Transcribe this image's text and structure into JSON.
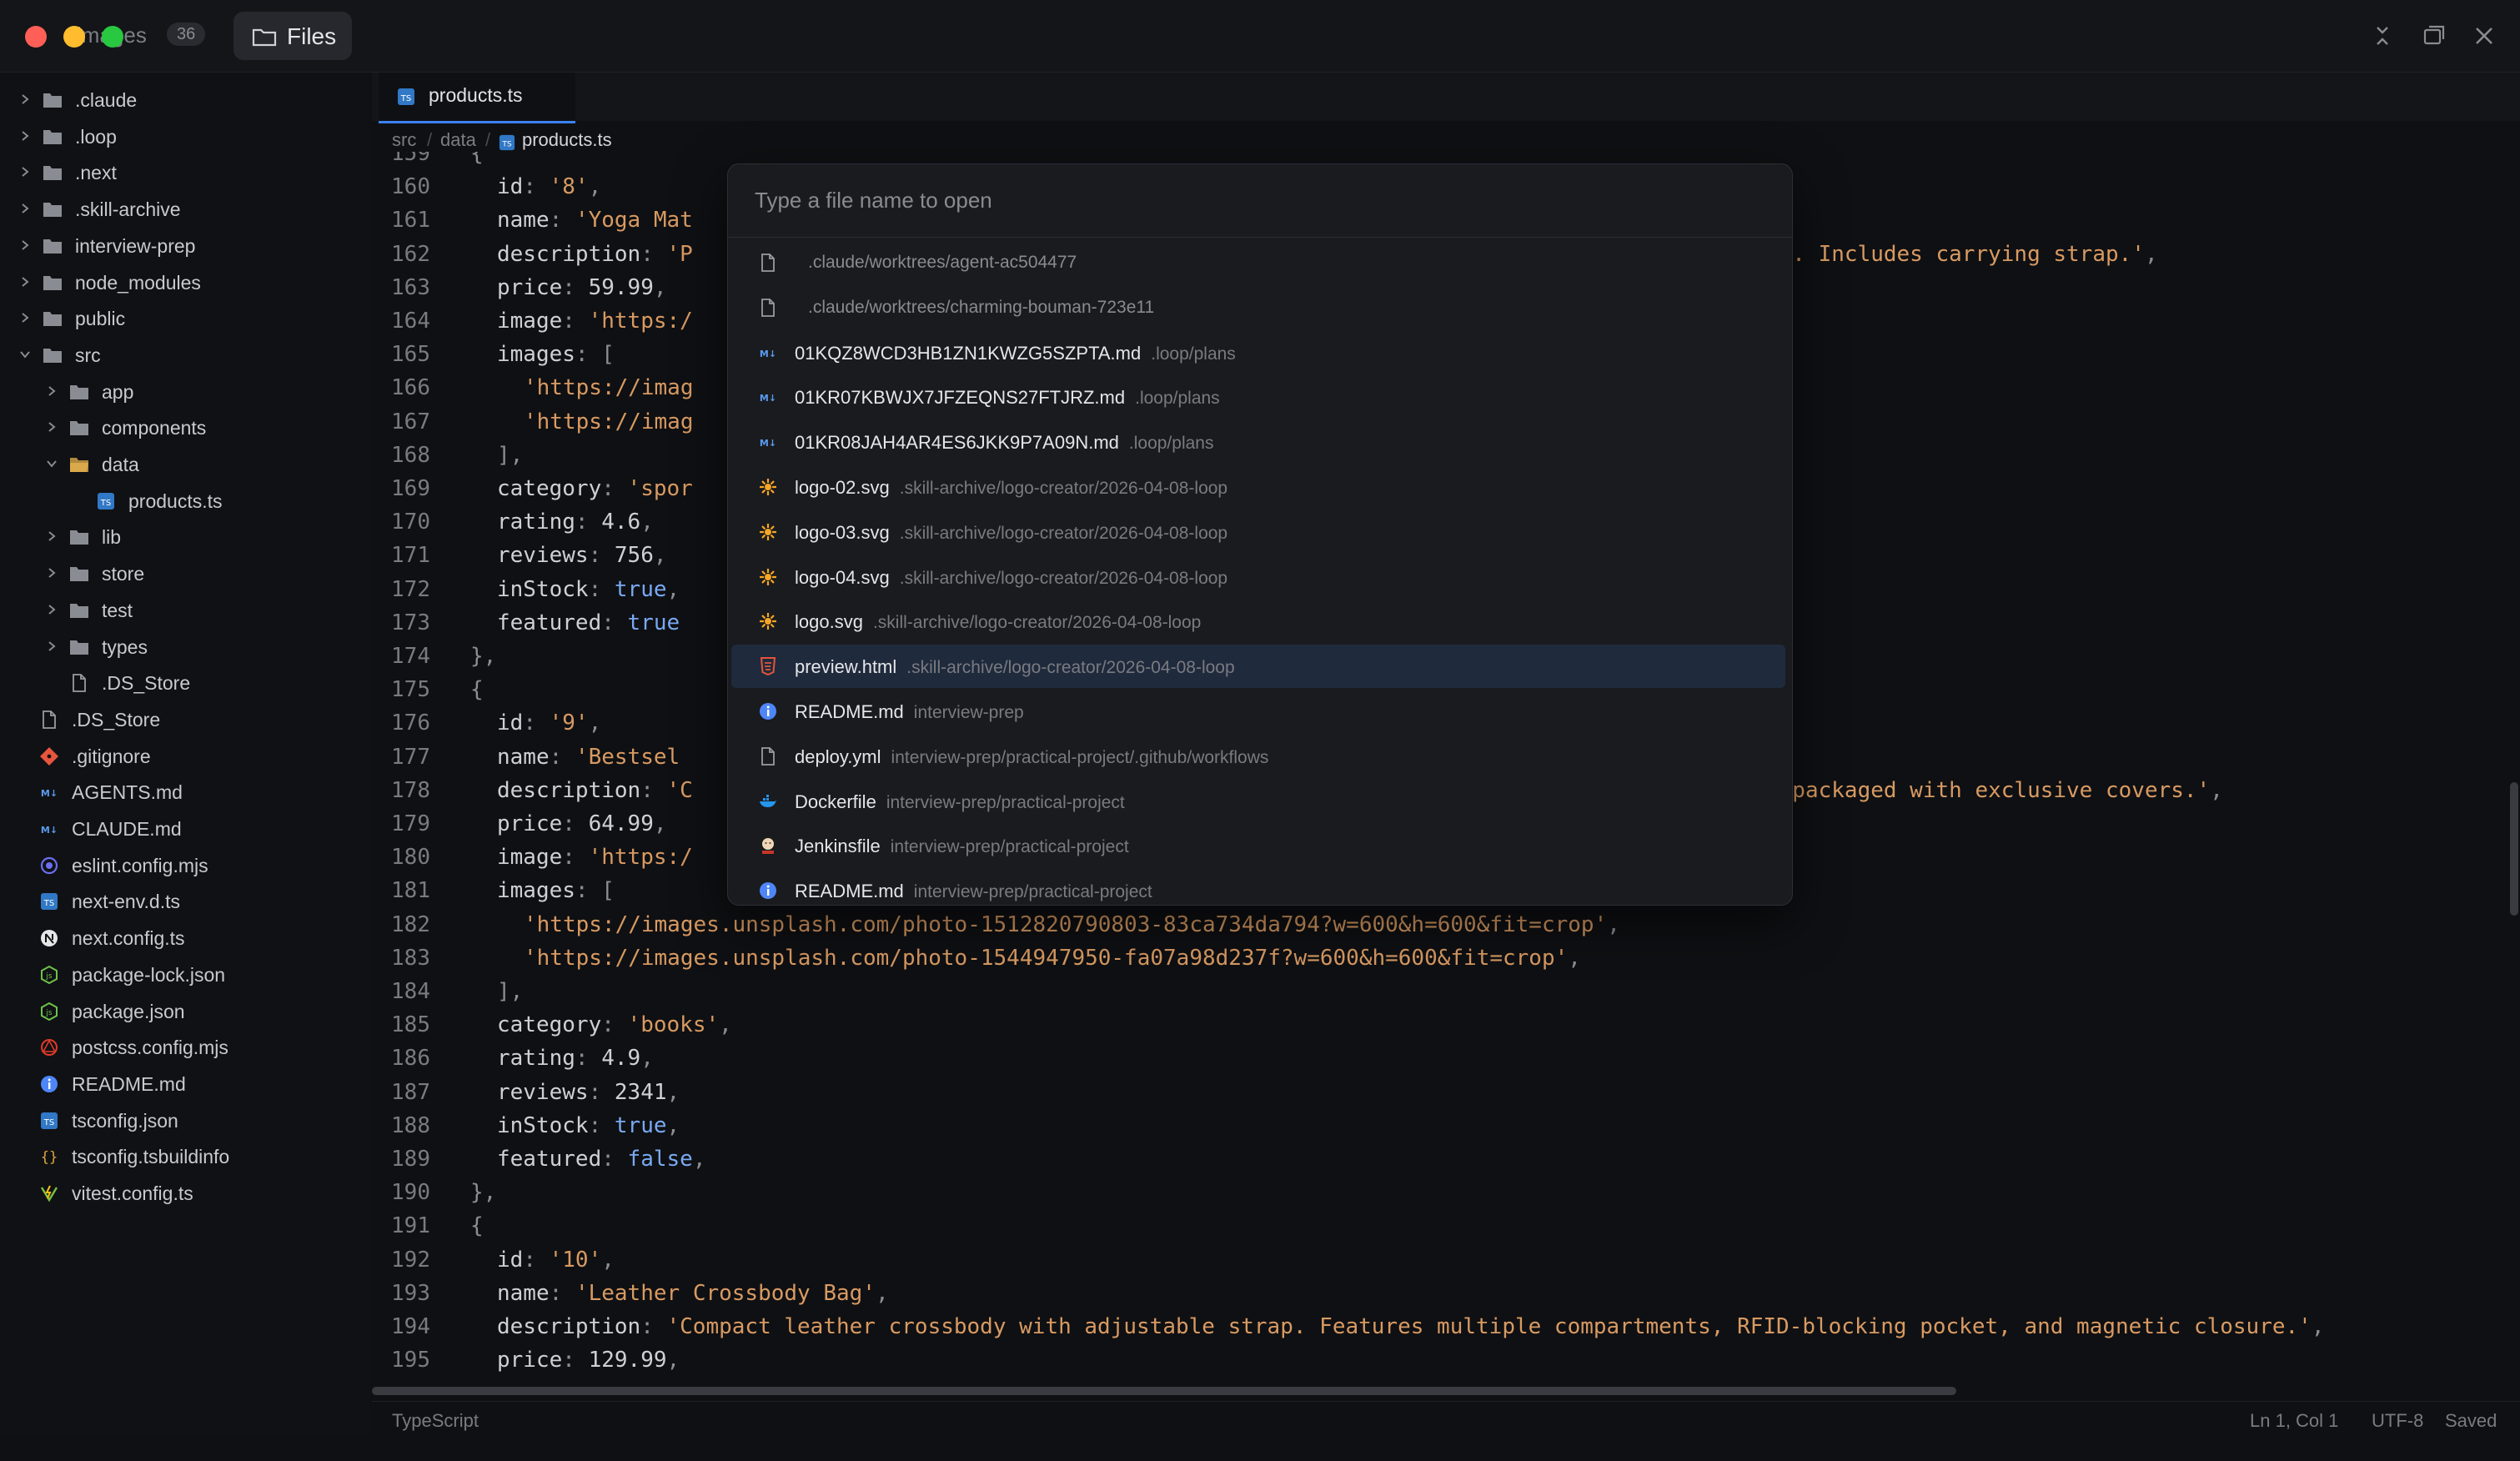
{
  "titlebar": {
    "app_title": "images",
    "count": "36",
    "files_tab": "Files"
  },
  "sidebar": {
    "items": [
      {
        "label": ".claude",
        "depth": 0,
        "kind": "folder",
        "expanded": false
      },
      {
        "label": ".loop",
        "depth": 0,
        "kind": "folder",
        "expanded": false
      },
      {
        "label": ".next",
        "depth": 0,
        "kind": "folder",
        "expanded": false
      },
      {
        "label": ".skill-archive",
        "depth": 0,
        "kind": "folder",
        "expanded": false
      },
      {
        "label": "interview-prep",
        "depth": 0,
        "kind": "folder",
        "expanded": false
      },
      {
        "label": "node_modules",
        "depth": 0,
        "kind": "folder",
        "expanded": false
      },
      {
        "label": "public",
        "depth": 0,
        "kind": "folder",
        "expanded": false
      },
      {
        "label": "src",
        "depth": 0,
        "kind": "folder",
        "expanded": true
      },
      {
        "label": "app",
        "depth": 1,
        "kind": "folder",
        "expanded": false
      },
      {
        "label": "components",
        "depth": 1,
        "kind": "folder",
        "expanded": false
      },
      {
        "label": "data",
        "depth": 1,
        "kind": "folder",
        "expanded": true
      },
      {
        "label": "products.ts",
        "depth": 2,
        "kind": "ts"
      },
      {
        "label": "lib",
        "depth": 1,
        "kind": "folder",
        "expanded": false
      },
      {
        "label": "store",
        "depth": 1,
        "kind": "folder",
        "expanded": false
      },
      {
        "label": "test",
        "depth": 1,
        "kind": "folder",
        "expanded": false
      },
      {
        "label": "types",
        "depth": 1,
        "kind": "folder",
        "expanded": false
      },
      {
        "label": ".DS_Store",
        "depth": 1,
        "kind": "file"
      },
      {
        "label": ".DS_Store",
        "depth": 0,
        "kind": "file"
      },
      {
        "label": ".gitignore",
        "depth": 0,
        "kind": "git"
      },
      {
        "label": "AGENTS.md",
        "depth": 0,
        "kind": "md"
      },
      {
        "label": "CLAUDE.md",
        "depth": 0,
        "kind": "md"
      },
      {
        "label": "eslint.config.mjs",
        "depth": 0,
        "kind": "eslint"
      },
      {
        "label": "next-env.d.ts",
        "depth": 0,
        "kind": "ts"
      },
      {
        "label": "next.config.ts",
        "depth": 0,
        "kind": "next"
      },
      {
        "label": "package-lock.json",
        "depth": 0,
        "kind": "node"
      },
      {
        "label": "package.json",
        "depth": 0,
        "kind": "node"
      },
      {
        "label": "postcss.config.mjs",
        "depth": 0,
        "kind": "postcss"
      },
      {
        "label": "README.md",
        "depth": 0,
        "kind": "info"
      },
      {
        "label": "tsconfig.json",
        "depth": 0,
        "kind": "ts"
      },
      {
        "label": "tsconfig.tsbuildinfo",
        "depth": 0,
        "kind": "braces"
      },
      {
        "label": "vitest.config.ts",
        "depth": 0,
        "kind": "vitest"
      }
    ]
  },
  "editor": {
    "tab_label": "products.ts",
    "breadcrumb": [
      "src",
      "data",
      "products.ts"
    ],
    "lines": [
      {
        "n": "159",
        "indent": 1,
        "parts": [
          [
            "p",
            "{"
          ]
        ]
      },
      {
        "n": "160",
        "indent": 2,
        "parts": [
          [
            "k",
            "id"
          ],
          [
            "p",
            ": "
          ],
          [
            "s",
            "'8'"
          ],
          [
            "p",
            ","
          ]
        ]
      },
      {
        "n": "161",
        "indent": 2,
        "parts": [
          [
            "k",
            "name"
          ],
          [
            "p",
            ": "
          ],
          [
            "s",
            "'Yoga Mat"
          ]
        ]
      },
      {
        "n": "162",
        "indent": 2,
        "parts": [
          [
            "k",
            "description"
          ],
          [
            "p",
            ": "
          ],
          [
            "s",
            "'P"
          ]
        ],
        "tail": [
          [
            "s",
            "al. Includes carrying strap.'"
          ],
          [
            "p",
            ","
          ]
        ]
      },
      {
        "n": "163",
        "indent": 2,
        "parts": [
          [
            "k",
            "price"
          ],
          [
            "p",
            ": "
          ],
          [
            "n",
            "59.99"
          ],
          [
            "p",
            ","
          ]
        ]
      },
      {
        "n": "164",
        "indent": 2,
        "parts": [
          [
            "k",
            "image"
          ],
          [
            "p",
            ": "
          ],
          [
            "s",
            "'https:/"
          ]
        ]
      },
      {
        "n": "165",
        "indent": 2,
        "parts": [
          [
            "k",
            "images"
          ],
          [
            "p",
            ": ["
          ]
        ]
      },
      {
        "n": "166",
        "indent": 3,
        "parts": [
          [
            "s",
            "'https://imag"
          ]
        ]
      },
      {
        "n": "167",
        "indent": 3,
        "parts": [
          [
            "s",
            "'https://imag"
          ]
        ]
      },
      {
        "n": "168",
        "indent": 2,
        "parts": [
          [
            "p",
            "],"
          ]
        ]
      },
      {
        "n": "169",
        "indent": 2,
        "parts": [
          [
            "k",
            "category"
          ],
          [
            "p",
            ": "
          ],
          [
            "s",
            "'spor"
          ]
        ]
      },
      {
        "n": "170",
        "indent": 2,
        "parts": [
          [
            "k",
            "rating"
          ],
          [
            "p",
            ": "
          ],
          [
            "n",
            "4.6"
          ],
          [
            "p",
            ","
          ]
        ]
      },
      {
        "n": "171",
        "indent": 2,
        "parts": [
          [
            "k",
            "reviews"
          ],
          [
            "p",
            ": "
          ],
          [
            "n",
            "756"
          ],
          [
            "p",
            ","
          ]
        ]
      },
      {
        "n": "172",
        "indent": 2,
        "parts": [
          [
            "k",
            "inStock"
          ],
          [
            "p",
            ": "
          ],
          [
            "b",
            "true"
          ],
          [
            "p",
            ","
          ]
        ]
      },
      {
        "n": "173",
        "indent": 2,
        "parts": [
          [
            "k",
            "featured"
          ],
          [
            "p",
            ": "
          ],
          [
            "b",
            "true"
          ]
        ]
      },
      {
        "n": "174",
        "indent": 1,
        "parts": [
          [
            "p",
            "},"
          ]
        ]
      },
      {
        "n": "175",
        "indent": 1,
        "parts": [
          [
            "p",
            "{"
          ]
        ]
      },
      {
        "n": "176",
        "indent": 2,
        "parts": [
          [
            "k",
            "id"
          ],
          [
            "p",
            ": "
          ],
          [
            "s",
            "'9'"
          ],
          [
            "p",
            ","
          ]
        ]
      },
      {
        "n": "177",
        "indent": 2,
        "parts": [
          [
            "k",
            "name"
          ],
          [
            "p",
            ": "
          ],
          [
            "s",
            "'Bestsel"
          ]
        ]
      },
      {
        "n": "178",
        "indent": 2,
        "parts": [
          [
            "k",
            "description"
          ],
          [
            "p",
            ": "
          ],
          [
            "s",
            "'C"
          ]
        ],
        "tail": [
          [
            "s",
            "y packaged with exclusive covers.'"
          ],
          [
            "p",
            ","
          ]
        ]
      },
      {
        "n": "179",
        "indent": 2,
        "parts": [
          [
            "k",
            "price"
          ],
          [
            "p",
            ": "
          ],
          [
            "n",
            "64.99"
          ],
          [
            "p",
            ","
          ]
        ]
      },
      {
        "n": "180",
        "indent": 2,
        "parts": [
          [
            "k",
            "image"
          ],
          [
            "p",
            ": "
          ],
          [
            "s",
            "'https:/"
          ]
        ]
      },
      {
        "n": "181",
        "indent": 2,
        "parts": [
          [
            "k",
            "images"
          ],
          [
            "p",
            ": ["
          ]
        ]
      },
      {
        "n": "182",
        "indent": 3,
        "parts": [
          [
            "s",
            "'https://images.unsplash.com/photo-1512820790803-83ca734da794?w=600&h=600&fit=crop'"
          ],
          [
            "p",
            ","
          ]
        ]
      },
      {
        "n": "183",
        "indent": 3,
        "parts": [
          [
            "s",
            "'https://images.unsplash.com/photo-1544947950-fa07a98d237f?w=600&h=600&fit=crop'"
          ],
          [
            "p",
            ","
          ]
        ]
      },
      {
        "n": "184",
        "indent": 2,
        "parts": [
          [
            "p",
            "],"
          ]
        ]
      },
      {
        "n": "185",
        "indent": 2,
        "parts": [
          [
            "k",
            "category"
          ],
          [
            "p",
            ": "
          ],
          [
            "s",
            "'books'"
          ],
          [
            "p",
            ","
          ]
        ]
      },
      {
        "n": "186",
        "indent": 2,
        "parts": [
          [
            "k",
            "rating"
          ],
          [
            "p",
            ": "
          ],
          [
            "n",
            "4.9"
          ],
          [
            "p",
            ","
          ]
        ]
      },
      {
        "n": "187",
        "indent": 2,
        "parts": [
          [
            "k",
            "reviews"
          ],
          [
            "p",
            ": "
          ],
          [
            "n",
            "2341"
          ],
          [
            "p",
            ","
          ]
        ]
      },
      {
        "n": "188",
        "indent": 2,
        "parts": [
          [
            "k",
            "inStock"
          ],
          [
            "p",
            ": "
          ],
          [
            "b",
            "true"
          ],
          [
            "p",
            ","
          ]
        ]
      },
      {
        "n": "189",
        "indent": 2,
        "parts": [
          [
            "k",
            "featured"
          ],
          [
            "p",
            ": "
          ],
          [
            "b",
            "false"
          ],
          [
            "p",
            ","
          ]
        ]
      },
      {
        "n": "190",
        "indent": 1,
        "parts": [
          [
            "p",
            "},"
          ]
        ]
      },
      {
        "n": "191",
        "indent": 1,
        "parts": [
          [
            "p",
            "{"
          ]
        ]
      },
      {
        "n": "192",
        "indent": 2,
        "parts": [
          [
            "k",
            "id"
          ],
          [
            "p",
            ": "
          ],
          [
            "s",
            "'10'"
          ],
          [
            "p",
            ","
          ]
        ]
      },
      {
        "n": "193",
        "indent": 2,
        "parts": [
          [
            "k",
            "name"
          ],
          [
            "p",
            ": "
          ],
          [
            "s",
            "'Leather Crossbody Bag'"
          ],
          [
            "p",
            ","
          ]
        ]
      },
      {
        "n": "194",
        "indent": 2,
        "parts": [
          [
            "k",
            "description"
          ],
          [
            "p",
            ": "
          ],
          [
            "s",
            "'Compact leather crossbody with adjustable strap. Features multiple compartments, RFID-blocking pocket, and magnetic closure.'"
          ],
          [
            "p",
            ","
          ]
        ]
      },
      {
        "n": "195",
        "indent": 2,
        "parts": [
          [
            "k",
            "price"
          ],
          [
            "p",
            ": "
          ],
          [
            "n",
            "129.99"
          ],
          [
            "p",
            ","
          ]
        ]
      }
    ]
  },
  "statusbar": {
    "language": "TypeScript",
    "position": "Ln 1, Col 1",
    "encoding": "UTF-8",
    "save_state": "Saved"
  },
  "palette": {
    "placeholder": "Type a file name to open",
    "selected_index": 9,
    "items": [
      {
        "name": "",
        "path": ".claude/worktrees/agent-ac504477",
        "icon": "file"
      },
      {
        "name": "",
        "path": ".claude/worktrees/charming-bouman-723e11",
        "icon": "file"
      },
      {
        "name": "01KQZ8WCD3HB1ZN1KWZG5SZPTA.md",
        "path": ".loop/plans",
        "icon": "md"
      },
      {
        "name": "01KR07KBWJX7JFZEQNS27FTJRZ.md",
        "path": ".loop/plans",
        "icon": "md"
      },
      {
        "name": "01KR08JAH4AR4ES6JKK9P7A09N.md",
        "path": ".loop/plans",
        "icon": "md"
      },
      {
        "name": "logo-02.svg",
        "path": ".skill-archive/logo-creator/2026-04-08-loop",
        "icon": "svg"
      },
      {
        "name": "logo-03.svg",
        "path": ".skill-archive/logo-creator/2026-04-08-loop",
        "icon": "svg"
      },
      {
        "name": "logo-04.svg",
        "path": ".skill-archive/logo-creator/2026-04-08-loop",
        "icon": "svg"
      },
      {
        "name": "logo.svg",
        "path": ".skill-archive/logo-creator/2026-04-08-loop",
        "icon": "svg"
      },
      {
        "name": "preview.html",
        "path": ".skill-archive/logo-creator/2026-04-08-loop",
        "icon": "html"
      },
      {
        "name": "README.md",
        "path": "interview-prep",
        "icon": "info"
      },
      {
        "name": "deploy.yml",
        "path": "interview-prep/practical-project/.github/workflows",
        "icon": "file"
      },
      {
        "name": "Dockerfile",
        "path": "interview-prep/practical-project",
        "icon": "docker"
      },
      {
        "name": "Jenkinsfile",
        "path": "interview-prep/practical-project",
        "icon": "jenkins"
      },
      {
        "name": "README.md",
        "path": "interview-prep/practical-project",
        "icon": "info"
      }
    ]
  },
  "colors": {
    "accent": "#3b82f6",
    "string": "#d89a62",
    "boolean": "#79a9f2",
    "selection": "#1f2a3d"
  }
}
